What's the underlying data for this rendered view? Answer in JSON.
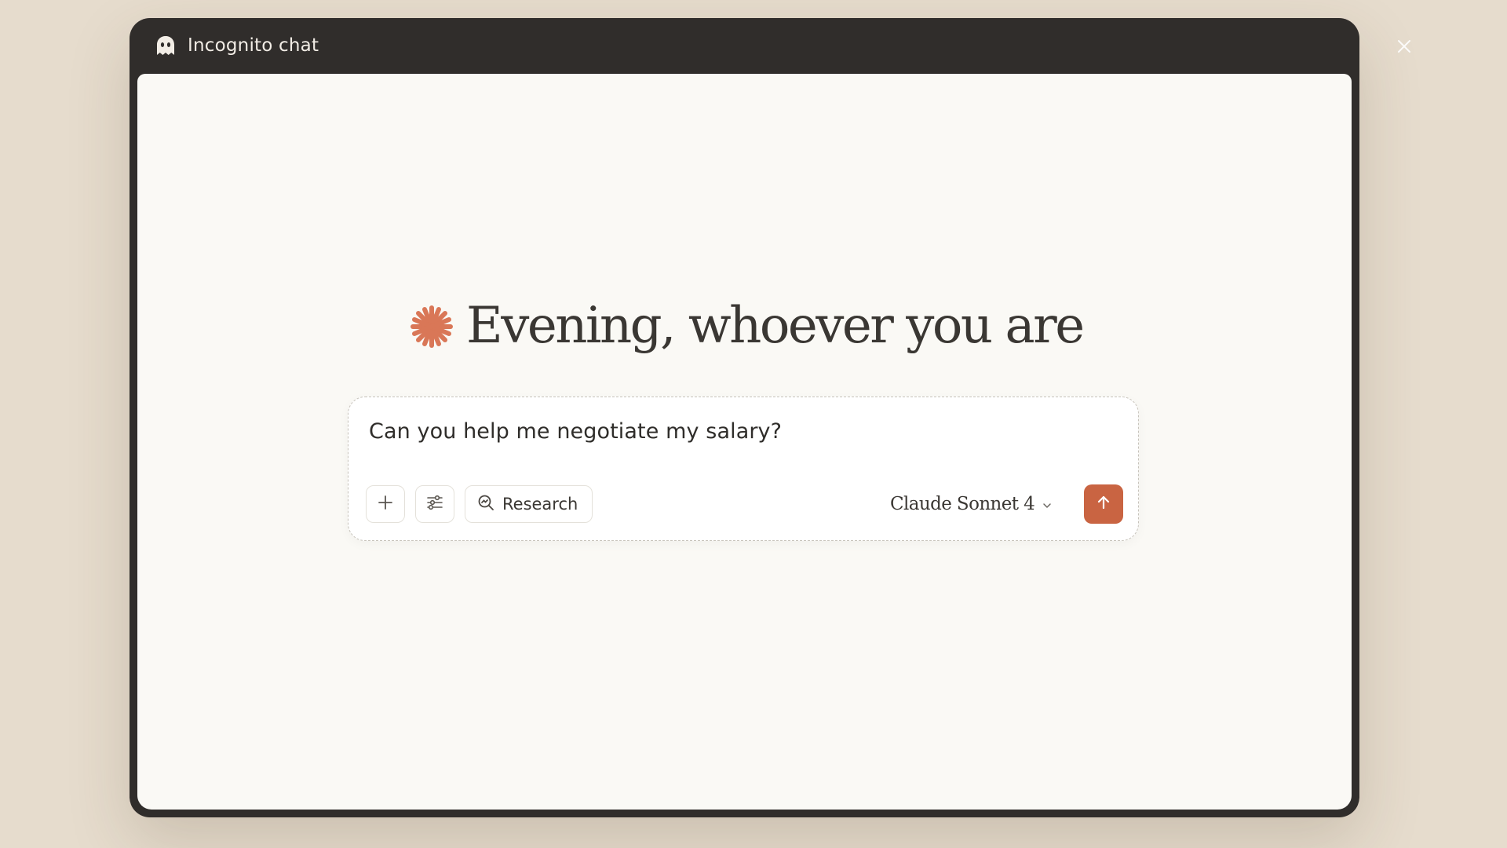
{
  "window": {
    "title": "Incognito chat",
    "icon": "ghost-icon"
  },
  "close_icon": "close-icon",
  "greeting": {
    "icon": "claude-spark-icon",
    "text": "Evening, whoever you are"
  },
  "composer": {
    "input_value": "Can you help me negotiate my salary?",
    "add_icon": "plus-icon",
    "tools_icon": "sliders-icon",
    "research_icon": "search-icon",
    "research_label": "Research",
    "model_label": "Claude Sonnet 4",
    "model_icon": "chevron-down-icon",
    "send_icon": "arrow-up-icon"
  },
  "colors": {
    "background": "#e6dccd",
    "window_frame": "#302d2b",
    "content_bg": "#faf9f5",
    "accent": "#c96442",
    "text": "#3a3733"
  }
}
